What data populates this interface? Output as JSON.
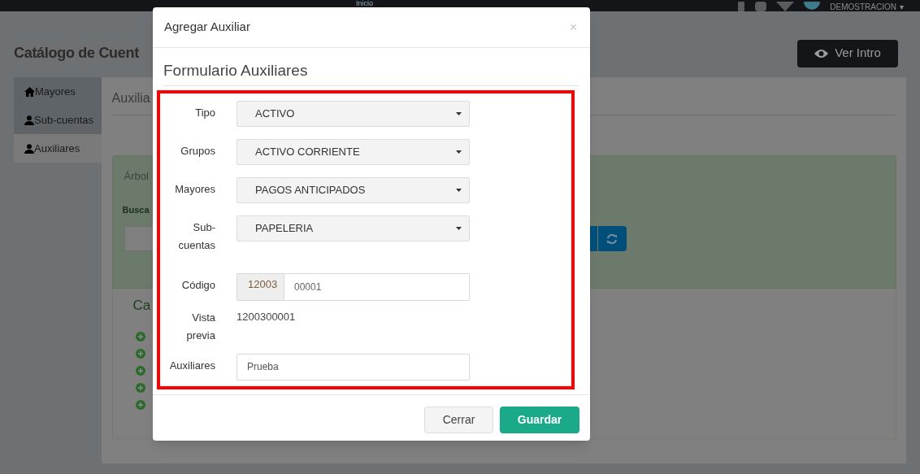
{
  "header": {
    "nav_link": "Inicio",
    "user": "DEMOSTRACION",
    "user_caret": "▾"
  },
  "page": {
    "title": "Catálogo de Cuent",
    "intro_button": "Ver Intro"
  },
  "sidebar": {
    "items": [
      {
        "label": "Mayores",
        "selected": false
      },
      {
        "label": "Sub-cuentas",
        "selected": false
      },
      {
        "label": "Auxiliares",
        "selected": true
      }
    ]
  },
  "main": {
    "heading": "Auxilia",
    "panel_label": "Árbol",
    "search_label": "Busca",
    "tree_heading": "Ca",
    "tree_items": [
      {
        "expanded": false
      },
      {
        "expanded": false
      },
      {
        "expanded": false
      },
      {
        "expanded": false
      },
      {
        "expanded": false
      }
    ]
  },
  "modal": {
    "title": "Agregar Auxiliar",
    "close": "×",
    "section_title": "Formulario Auxiliares",
    "fields": [
      {
        "kind": "select",
        "label": "Tipo",
        "value": "ACTIVO"
      },
      {
        "kind": "select",
        "label": "Grupos",
        "value": "ACTIVO CORRIENTE"
      },
      {
        "kind": "select",
        "label": "Mayores",
        "value": "PAGOS ANTICIPADOS"
      },
      {
        "kind": "select",
        "label": "Sub-cuentas",
        "value": "PAPELERIA"
      },
      {
        "kind": "prefixed",
        "label": "Código",
        "prefix": "12003",
        "value": "00001"
      },
      {
        "kind": "static",
        "label": "Vista previa",
        "value": "1200300001"
      },
      {
        "kind": "input",
        "label": "Auxiliares",
        "value": "Prueba"
      }
    ],
    "buttons": [
      {
        "label": "Cerrar",
        "kind": "default"
      },
      {
        "label": "Guardar",
        "kind": "primary"
      }
    ]
  }
}
